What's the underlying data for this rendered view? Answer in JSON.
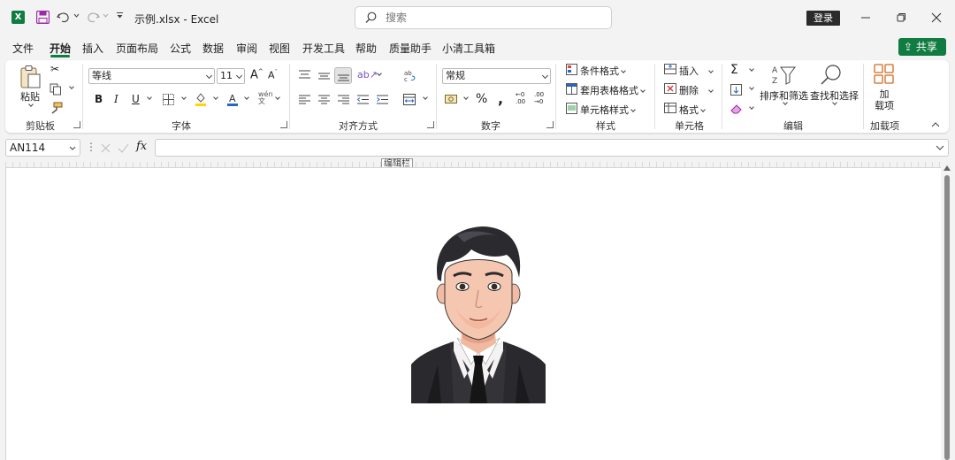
{
  "titlebar": {
    "doc_title": "示例.xlsx  -  Excel",
    "search_placeholder": "搜索",
    "login_label": "登录"
  },
  "menu": {
    "tabs": [
      "文件",
      "开始",
      "插入",
      "页面布局",
      "公式",
      "数据",
      "审阅",
      "视图",
      "开发工具",
      "帮助",
      "质量助手",
      "小清工具箱"
    ],
    "active_tab": "开始",
    "share_label": "共享"
  },
  "ribbon": {
    "clipboard": {
      "paste_label": "粘贴",
      "group_label": "剪贴板"
    },
    "font": {
      "font_name": "等线",
      "font_size": "11",
      "group_label": "字体"
    },
    "alignment": {
      "group_label": "对齐方式"
    },
    "number": {
      "format": "常规",
      "group_label": "数字"
    },
    "styles": {
      "conditional_format": "条件格式",
      "table_format": "套用表格格式",
      "cell_styles": "单元格样式",
      "group_label": "样式"
    },
    "cells": {
      "insert": "插入",
      "delete": "删除",
      "format": "格式",
      "group_label": "单元格"
    },
    "editing": {
      "sort_filter": "排序和筛选",
      "find_select": "查找和选择",
      "group_label": "编辑"
    },
    "addins": {
      "label_line1": "加",
      "label_line2": "载项",
      "group_label": "加载项"
    }
  },
  "formulabar": {
    "name_box": "AN114",
    "fx_label": "fx",
    "formula_value": "",
    "tooltip": "编辑栏"
  },
  "colors": {
    "accent_green": "#107c41",
    "ribbon_bg": "#ffffff",
    "window_bg": "#f3f3f3"
  }
}
